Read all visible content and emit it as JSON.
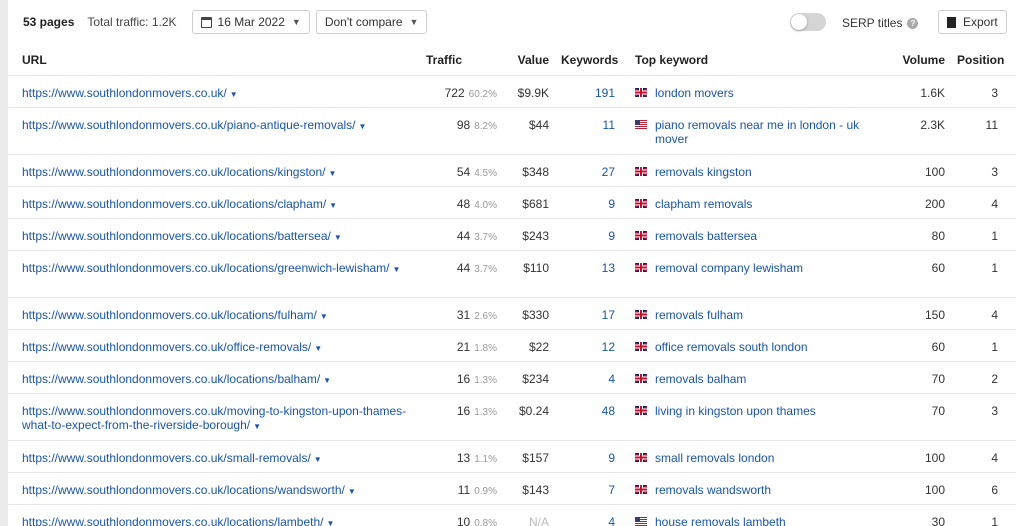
{
  "toolbar": {
    "pages_count": "53 pages",
    "total_traffic": "Total traffic: 1.2K",
    "date": "16 Mar 2022",
    "compare": "Don't compare",
    "serp_titles": "SERP titles",
    "export": "Export"
  },
  "table": {
    "headers": {
      "url": "URL",
      "traffic": "Traffic",
      "value": "Value",
      "keywords": "Keywords",
      "top_keyword": "Top keyword",
      "volume": "Volume",
      "position": "Position"
    },
    "rows": [
      {
        "url": "https://www.southlondonmovers.co.uk/",
        "traffic": "722",
        "pct": "60.2%",
        "value": "$9.9K",
        "keywords": "191",
        "flag": "gb",
        "top_keyword": "london movers",
        "volume": "1.6K",
        "position": "3"
      },
      {
        "url": "https://www.southlondonmovers.co.uk/piano-antique-removals/",
        "traffic": "98",
        "pct": "8.2%",
        "value": "$44",
        "keywords": "11",
        "flag": "us",
        "top_keyword": "piano removals near me in london - uk mover",
        "volume": "2.3K",
        "position": "11"
      },
      {
        "url": "https://www.southlondonmovers.co.uk/locations/kingston/",
        "traffic": "54",
        "pct": "4.5%",
        "value": "$348",
        "keywords": "27",
        "flag": "gb",
        "top_keyword": "removals kingston",
        "volume": "100",
        "position": "3"
      },
      {
        "url": "https://www.southlondonmovers.co.uk/locations/clapham/",
        "traffic": "48",
        "pct": "4.0%",
        "value": "$681",
        "keywords": "9",
        "flag": "gb",
        "top_keyword": "clapham removals",
        "volume": "200",
        "position": "4"
      },
      {
        "url": "https://www.southlondonmovers.co.uk/locations/battersea/",
        "traffic": "44",
        "pct": "3.7%",
        "value": "$243",
        "keywords": "9",
        "flag": "gb",
        "top_keyword": "removals battersea",
        "volume": "80",
        "position": "1"
      },
      {
        "url": "https://www.southlondonmovers.co.uk/locations/greenwich-lewisham/",
        "traffic": "44",
        "pct": "3.7%",
        "value": "$110",
        "keywords": "13",
        "flag": "gb",
        "top_keyword": "removal company lewisham",
        "volume": "60",
        "position": "1"
      },
      {
        "url": "https://www.southlondonmovers.co.uk/locations/fulham/",
        "traffic": "31",
        "pct": "2.6%",
        "value": "$330",
        "keywords": "17",
        "flag": "gb",
        "top_keyword": "removals fulham",
        "volume": "150",
        "position": "4"
      },
      {
        "url": "https://www.southlondonmovers.co.uk/office-removals/",
        "traffic": "21",
        "pct": "1.8%",
        "value": "$22",
        "keywords": "12",
        "flag": "gb",
        "top_keyword": "office removals south london",
        "volume": "60",
        "position": "1"
      },
      {
        "url": "https://www.southlondonmovers.co.uk/locations/balham/",
        "traffic": "16",
        "pct": "1.3%",
        "value": "$234",
        "keywords": "4",
        "flag": "gb",
        "top_keyword": "removals balham",
        "volume": "70",
        "position": "2"
      },
      {
        "url": "https://www.southlondonmovers.co.uk/moving-to-kingston-upon-thames-what-to-expect-from-the-riverside-borough/",
        "traffic": "16",
        "pct": "1.3%",
        "value": "$0.24",
        "keywords": "48",
        "flag": "gb",
        "top_keyword": "living in kingston upon thames",
        "volume": "70",
        "position": "3"
      },
      {
        "url": "https://www.southlondonmovers.co.uk/small-removals/",
        "traffic": "13",
        "pct": "1.1%",
        "value": "$157",
        "keywords": "9",
        "flag": "gb",
        "top_keyword": "small removals london",
        "volume": "100",
        "position": "4"
      },
      {
        "url": "https://www.southlondonmovers.co.uk/locations/wandsworth/",
        "traffic": "11",
        "pct": "0.9%",
        "value": "$143",
        "keywords": "7",
        "flag": "gb",
        "top_keyword": "removals wandsworth",
        "volume": "100",
        "position": "6"
      },
      {
        "url": "https://www.southlondonmovers.co.uk/locations/lambeth/",
        "traffic": "10",
        "pct": "0.8%",
        "value": "N/A",
        "keywords": "4",
        "flag": "us",
        "top_keyword": "house removals lambeth",
        "volume": "30",
        "position": "1"
      }
    ]
  }
}
